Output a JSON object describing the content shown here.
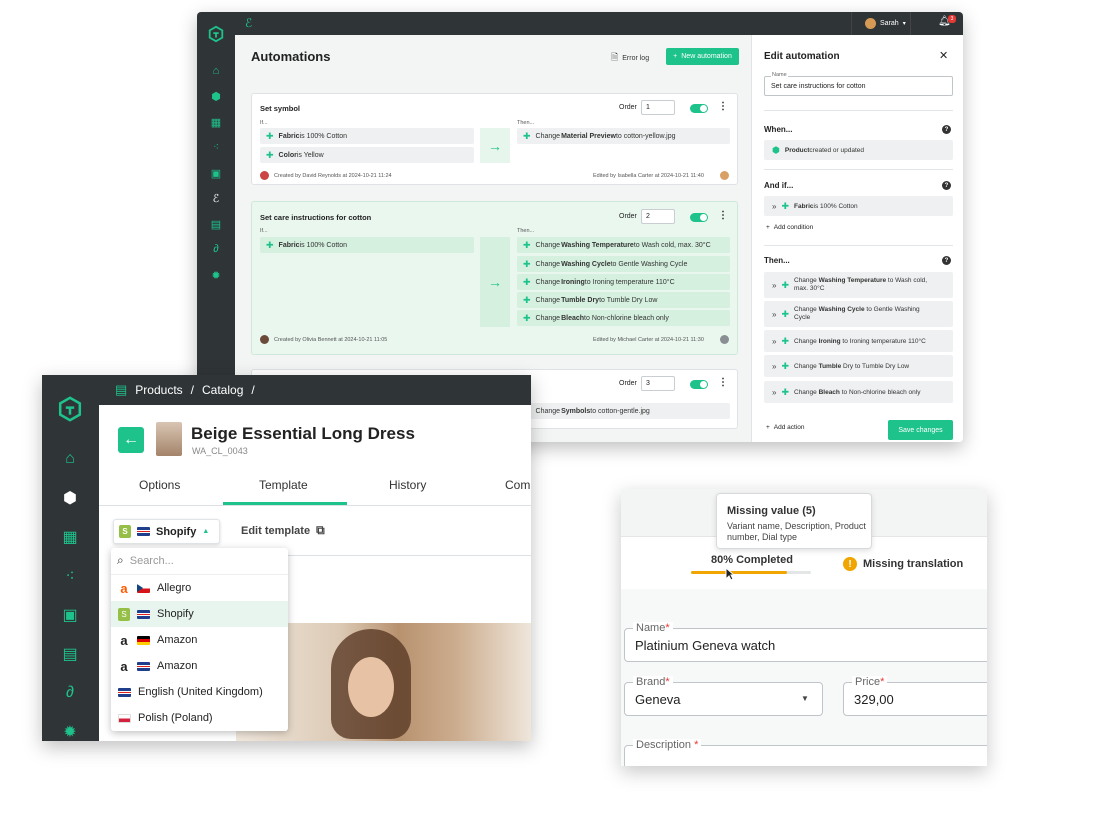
{
  "automations": {
    "title": "Automations",
    "error_log": "Error log",
    "new_automation": "New automation",
    "user": "Sarah",
    "order_label": "Order",
    "if_label": "If...",
    "then_label": "Then...",
    "cards": [
      {
        "title": "Set symbol",
        "order": "1",
        "conditions": [
          {
            "field": "Fabric",
            "rest": " is 100% Cotton"
          },
          {
            "field": "Color",
            "rest": " is Yellow"
          }
        ],
        "actions": [
          {
            "pre": "Change ",
            "field": "Material Preview",
            "rest": " to cotton-yellow.jpg"
          }
        ],
        "created": "Created by David Reynolds at 2024-10-21 11:24",
        "edited": "Edited by Isabella Carter at 2024-10-21 11:40"
      },
      {
        "title": "Set care instructions for cotton",
        "order": "2",
        "conditions": [
          {
            "field": "Fabric",
            "rest": " is 100% Cotton"
          }
        ],
        "actions": [
          {
            "pre": "Change ",
            "field": "Washing Temperature",
            "rest": " to Wash cold, max. 30°C"
          },
          {
            "pre": "Change ",
            "field": "Washing Cycle",
            "rest": " to Gentle Washing Cycle"
          },
          {
            "pre": "Change ",
            "field": "Ironing",
            "rest": " to Ironing temperature 110°C"
          },
          {
            "pre": "Change ",
            "field": "Tumble Dry",
            "rest": " to Tumble Dry Low"
          },
          {
            "pre": "Change ",
            "field": "Bleach",
            "rest": " to Non-chlorine bleach only"
          }
        ],
        "created": "Created by Olivia Bennett at 2024-10-21 11:05",
        "edited": "Edited by Michael Carter at 2024-10-21 11:30"
      },
      {
        "order": "3",
        "actions": [
          {
            "pre": "Change ",
            "field": "Symbols",
            "rest": " to cotton-gentle.jpg"
          }
        ]
      }
    ]
  },
  "edit_panel": {
    "title": "Edit automation",
    "name_label": "Name",
    "name_value": "Set care instructions for cotton",
    "when_label": "When...",
    "when_item": {
      "field": "Product",
      "rest": " created or updated"
    },
    "andif_label": "And if...",
    "andif_item": {
      "field": "Fabric",
      "rest": " is 100% Cotton"
    },
    "add_condition": "Add condition",
    "then_label": "Then...",
    "actions": [
      {
        "line1_pre": "Change ",
        "line1_field": "Washing Temperature",
        "line1_rest": " to Wash cold,",
        "line2": "max. 30°C"
      },
      {
        "line1_pre": "Change ",
        "line1_field": "Washing Cycle",
        "line1_rest": " to Gentle Washing",
        "line2": "Cycle"
      },
      {
        "line1_pre": "Change ",
        "line1_field": "Ironing",
        "line1_rest": " to Ironing temperature 110°C",
        "line2": ""
      },
      {
        "line1_pre": "Change ",
        "line1_field": "Tumble",
        "line1_rest": " Dry to Tumble Dry Low",
        "line2": ""
      },
      {
        "line1_pre": "Change ",
        "line1_field": "Bleach",
        "line1_rest": " to Non-chlorine bleach only",
        "line2": ""
      }
    ],
    "add_action": "Add action",
    "save": "Save changes"
  },
  "product": {
    "breadcrumb": [
      "Products",
      "Catalog"
    ],
    "sep": "/",
    "title": "Beige Essential Long Dress",
    "sku": "WA_CL_0043",
    "tabs": [
      "Options",
      "Template",
      "History",
      "Com"
    ],
    "active_tab": "Template",
    "channel": "Shopify",
    "edit_template": "Edit template",
    "search_placeholder": "Search...",
    "dropdown": [
      {
        "icon": "allegro-icon",
        "flag": "cz",
        "label": "Allegro"
      },
      {
        "icon": "shopify-icon",
        "flag": "uk",
        "label": "Shopify"
      },
      {
        "icon": "amazon-icon",
        "flag": "de",
        "label": "Amazon"
      },
      {
        "icon": "amazon-icon",
        "flag": "uk",
        "label": "Amazon"
      },
      {
        "icon": "",
        "flag": "uk",
        "label": "English (United Kingdom)"
      },
      {
        "icon": "",
        "flag": "pl",
        "label": "Polish (Poland)"
      }
    ]
  },
  "watch": {
    "tooltip_title": "Missing value (5)",
    "tooltip_body": "Variant name, Description, Product number, Dial type",
    "completed": "80% Completed",
    "completed_pct": 80,
    "missing_translation": "Missing translation",
    "name_label": "Name",
    "name_value": "Platinium Geneva watch",
    "brand_label": "Brand",
    "brand_value": "Geneva",
    "price_label": "Price",
    "price_value": "329,00",
    "description_label": "Description",
    "required_mark": "*"
  },
  "colors": {
    "accent": "#1ec38b",
    "sidebar": "#2f3437",
    "warning": "#f0a500"
  }
}
